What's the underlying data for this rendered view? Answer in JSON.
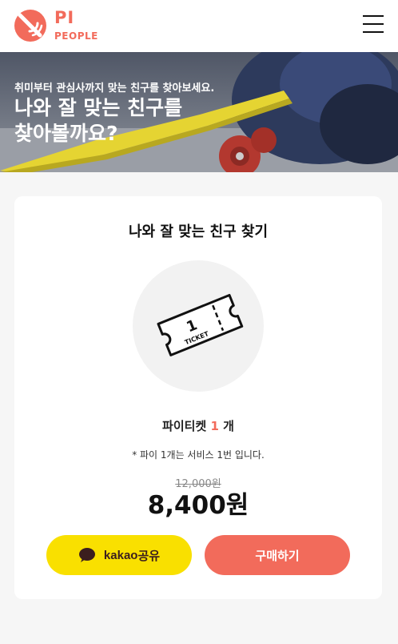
{
  "header": {
    "logo_pi": "PI",
    "logo_people": "PEOPLE"
  },
  "hero": {
    "subtitle": "취미부터 관심사까지 맞는 친구를 찾아보세요.",
    "title_line1": "나와 잘 맞는 친구를",
    "title_line2": "찾아볼까요?"
  },
  "card": {
    "title": "나와 잘 맞는 친구 찾기",
    "ticket_number": "1",
    "ticket_word": "TICKET",
    "count_prefix": "파이티켓 ",
    "count_value": "1",
    "count_suffix": " 개",
    "note": "* 파이 1개는 서비스 1번 입니다.",
    "price_original": "12,000원",
    "price_sale": "8,400원"
  },
  "buttons": {
    "kakao_brand": "kakao",
    "kakao_label": " 공유",
    "buy_label": "구매하기"
  },
  "colors": {
    "brand": "#f26b5b",
    "kakao": "#f9e000",
    "hero_board": "#e5d432"
  }
}
